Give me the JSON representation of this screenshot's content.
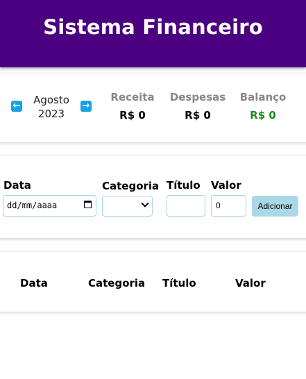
{
  "header": {
    "title": "Sistema Financeiro"
  },
  "period": {
    "month": "Agosto",
    "year": "2023",
    "prev_icon": "arrow-left-icon",
    "next_icon": "arrow-right-icon"
  },
  "summary": {
    "receita_label": "Receita",
    "receita_value": "R$ 0",
    "despesas_label": "Despesas",
    "despesas_value": "R$ 0",
    "balanco_label": "Balanço",
    "balanco_value": "R$ 0",
    "balanco_color": "#1a8a1a"
  },
  "form": {
    "date_label": "Data",
    "date_placeholder": "dd/mm/aaaa",
    "category_label": "Categoria",
    "category_selected": "",
    "title_label": "Título",
    "title_value": "",
    "value_label": "Valor",
    "value_value": "0",
    "add_button": "Adicionar"
  },
  "table": {
    "columns": [
      "Data",
      "Categoria",
      "Título",
      "Valor"
    ]
  },
  "colors": {
    "header_bg": "#4b0082",
    "accent": "#16a2e8",
    "button_bg": "#a9d8e6"
  }
}
